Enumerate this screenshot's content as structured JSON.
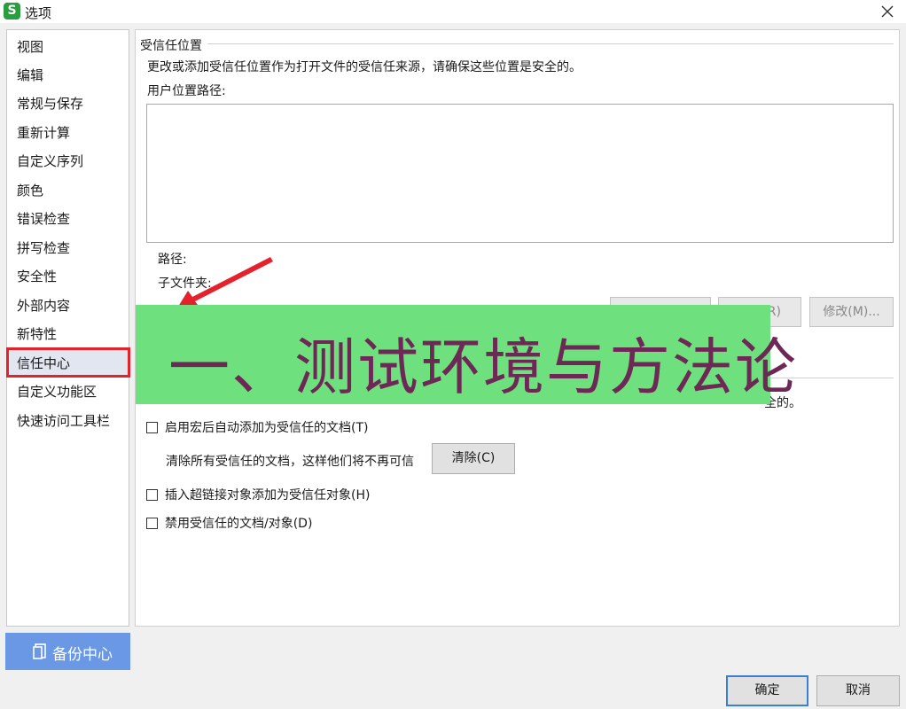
{
  "window": {
    "title": "选项",
    "app_icon_letter": "S",
    "accent_color": "#2a9d3e"
  },
  "sidebar": {
    "items": [
      {
        "label": "视图"
      },
      {
        "label": "编辑"
      },
      {
        "label": "常规与保存"
      },
      {
        "label": "重新计算"
      },
      {
        "label": "自定义序列"
      },
      {
        "label": "颜色"
      },
      {
        "label": "错误检查"
      },
      {
        "label": "拼写检查"
      },
      {
        "label": "安全性"
      },
      {
        "label": "外部内容"
      },
      {
        "label": "新特性"
      },
      {
        "label": "信任中心",
        "selected": true
      },
      {
        "label": "自定义功能区"
      },
      {
        "label": "快速访问工具栏"
      }
    ],
    "highlight_color": "#e3222b"
  },
  "backup": {
    "label": "备份中心",
    "icon": "document-icon",
    "color": "#6a98e5"
  },
  "trusted_locations": {
    "group_title": "受信任位置",
    "description": "更改或添加受信任位置作为打开文件的受信任来源，请确保这些位置是安全的。",
    "path_list_label": "用户位置路径:",
    "path_label": "路径:",
    "subfolder_label": "子文件夹:",
    "buttons": {
      "add": "",
      "delete": "R)",
      "modify": "修改(M)..."
    }
  },
  "trusted_docs": {
    "visible_fragment": "全的。",
    "auto_add_macro": "启用宏后自动添加为受信任的文档(T)",
    "clear_description": "清除所有受信任的文档，这样他们将不再可信",
    "clear_button": "清除(C)",
    "hyperlink_option": "插入超链接对象添加为受信任对象(H)",
    "disable_option": "禁用受信任的文档/对象(D)"
  },
  "overlay": {
    "banner_text": "一、测试环境与方法论",
    "banner_color": "#6fe07e",
    "text_color": "#6d2856",
    "arrow_color": "#e3222b"
  },
  "footer": {
    "ok": "确定",
    "cancel": "取消"
  }
}
